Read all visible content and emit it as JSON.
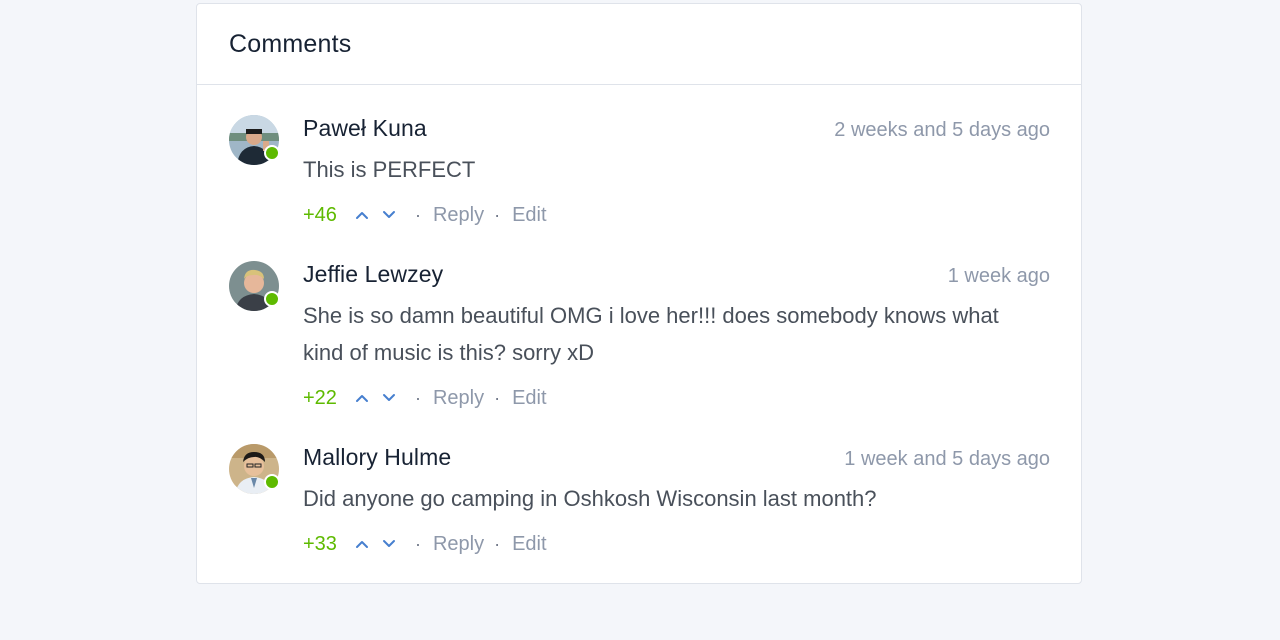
{
  "card": {
    "title": "Comments"
  },
  "colors": {
    "online": "#5eba00",
    "score": "#5eba00",
    "vote_arrow": "#467fcf",
    "muted": "#8e98aa"
  },
  "comments": [
    {
      "author": "Paweł Kuna",
      "time": "2 weeks and 5 days ago",
      "text": "This is PERFECT",
      "score": "+46",
      "reply_label": "Reply",
      "edit_label": "Edit",
      "avatar": "avatar-photo",
      "online": true
    },
    {
      "author": "Jeffie Lewzey",
      "time": "1 week ago",
      "text": "She is so damn beautiful OMG i love her!!! does somebody knows what kind of music is this? sorry xD",
      "score": "+22",
      "reply_label": "Reply",
      "edit_label": "Edit",
      "avatar": "avatar-photo",
      "online": true
    },
    {
      "author": "Mallory Hulme",
      "time": "1 week and 5 days ago",
      "text": "Did anyone go camping in Oshkosh Wisconsin last month?",
      "score": "+33",
      "reply_label": "Reply",
      "edit_label": "Edit",
      "avatar": "avatar-photo",
      "online": true
    }
  ],
  "icons": {
    "upvote": "chevron-up-icon",
    "downvote": "chevron-down-icon",
    "separator": "·"
  }
}
